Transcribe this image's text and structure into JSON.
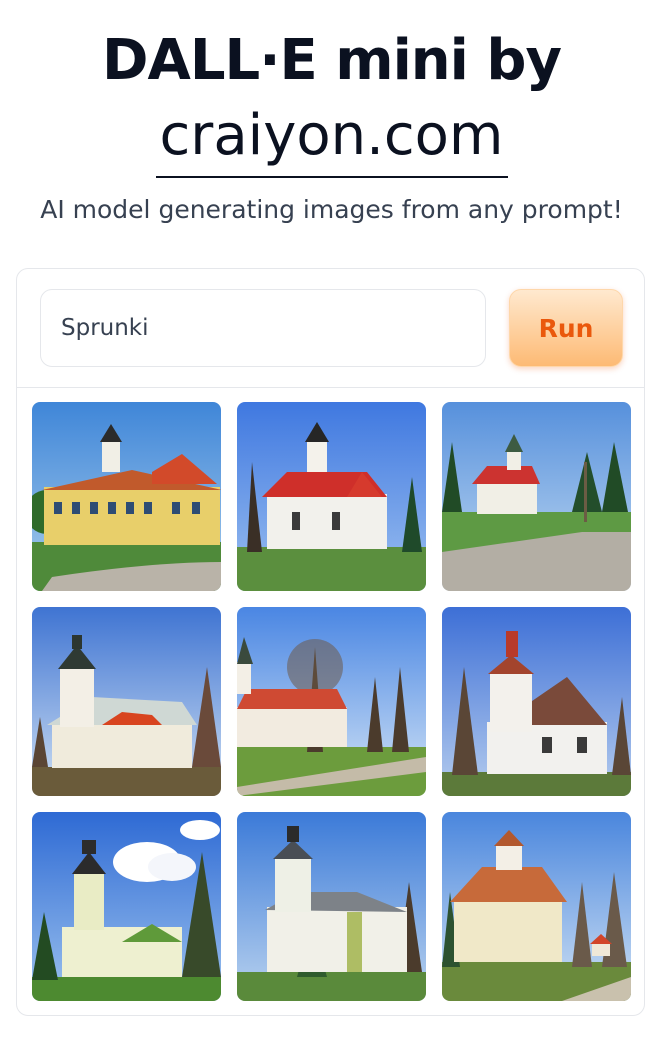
{
  "header": {
    "title": "DALL·E mini by",
    "site_link": "craiyon.com",
    "tagline": "AI model generating images from any prompt!"
  },
  "prompt": {
    "value": "Sprunki",
    "placeholder": ""
  },
  "run_button": {
    "label": "Run"
  },
  "results": {
    "count": 9,
    "alt": "Sprunki"
  },
  "colors": {
    "accent_orange": "#ea580c",
    "button_gradient_top": "#ffe9cf",
    "button_gradient_bottom": "#fdba74",
    "border": "#e5e7eb"
  }
}
